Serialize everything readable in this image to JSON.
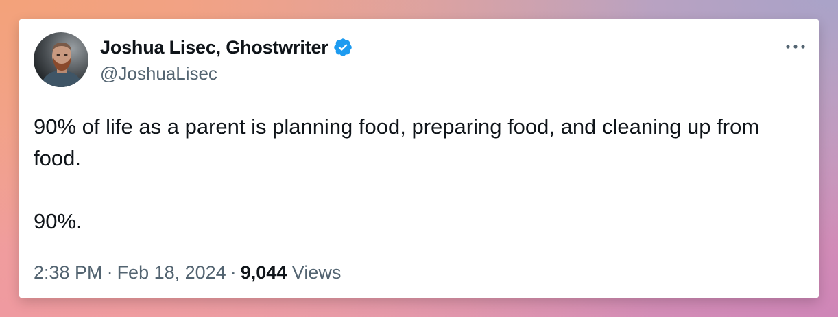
{
  "author": {
    "display_name": "Joshua Lisec, Ghostwriter",
    "handle": "@JoshuaLisec",
    "verified": true,
    "verified_color": "#1d9bf0"
  },
  "tweet": {
    "paragraphs": [
      "90% of life as a parent is planning food, preparing food, and cleaning up from food.",
      "90%."
    ]
  },
  "meta": {
    "time": "2:38 PM",
    "separator": "·",
    "date": "Feb 18, 2024",
    "views_count": "9,044",
    "views_label": "Views"
  },
  "icons": {
    "more": "more-horizontal-icon",
    "verified": "verified-badge-icon"
  },
  "colors": {
    "text_primary": "#0f1419",
    "text_secondary": "#536471",
    "card_background": "#ffffff"
  }
}
